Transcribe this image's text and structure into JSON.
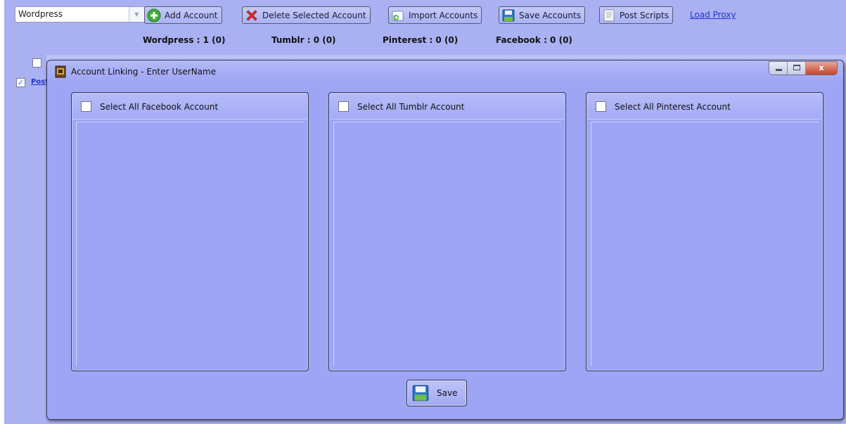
{
  "toolbar": {
    "platform_select": {
      "value": "Wordpress"
    },
    "buttons": [
      {
        "id": "add",
        "label": "Add Account",
        "icon": "add-icon"
      },
      {
        "id": "delete",
        "label": "Delete Selected Account",
        "icon": "delete-icon"
      },
      {
        "id": "import",
        "label": "Import Accounts",
        "icon": "import-icon"
      },
      {
        "id": "save",
        "label": "Save Accounts",
        "icon": "save-icon"
      },
      {
        "id": "scripts",
        "label": "Post Scripts",
        "icon": "script-icon"
      }
    ],
    "load_proxy": "Load Proxy"
  },
  "counts": [
    {
      "label": "Wordpress : 1 (0)"
    },
    {
      "label": "Tumblr : 0 (0)"
    },
    {
      "label": "Pinterest : 0 (0)"
    },
    {
      "label": "Facebook : 0 (0)"
    }
  ],
  "background_grid": {
    "row_link": "Post",
    "row_checked": true
  },
  "dialog": {
    "title": "Account Linking - Enter UserName",
    "panels": [
      {
        "label": "Select All Facebook Account",
        "checked": false
      },
      {
        "label": "Select All Tumblr Account",
        "checked": false
      },
      {
        "label": "Select All Pinterest Account",
        "checked": false
      }
    ],
    "save_label": "Save",
    "close_glyph": "x"
  },
  "colors": {
    "background": "#a9b1f3",
    "dialog": "#9ea5f5",
    "link": "#2233cc",
    "close": "#c3452b"
  }
}
